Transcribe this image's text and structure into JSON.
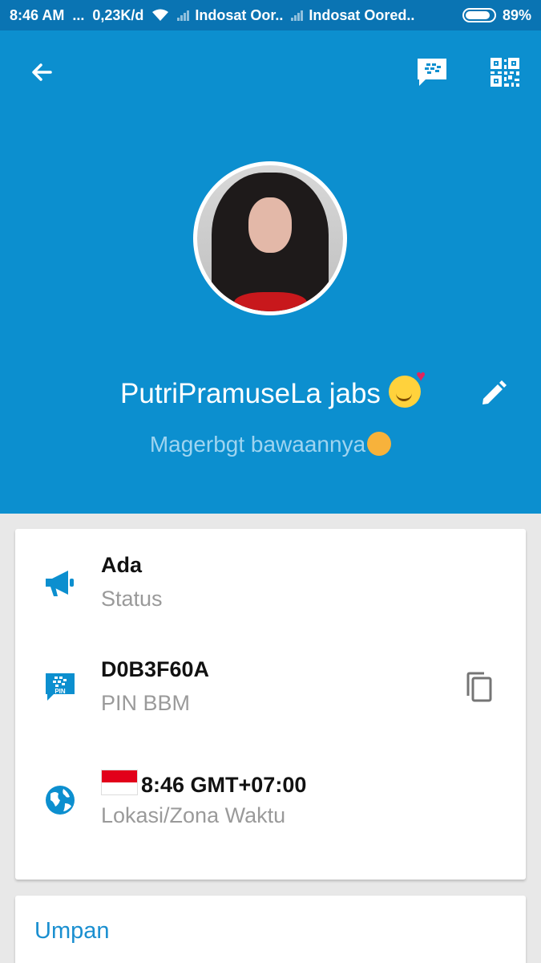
{
  "status_bar": {
    "time": "8:46 AM",
    "dots": "...",
    "speed": "0,23K/d",
    "carrier1": "Indosat Oor..",
    "carrier2": "Indosat Oored..",
    "battery": "89%"
  },
  "header": {
    "icons": [
      "back-arrow-icon",
      "bbm-chat-icon",
      "qr-code-icon"
    ],
    "name": "PutriPramuseLa jabs",
    "name_emoji": "smile-heart-emoji-icon",
    "status_message": "Magerbgt bawaannya",
    "status_emoji": "sad-emoji-icon",
    "bg_color": "#0c8fcf",
    "status_bar_color": "#0a74b3"
  },
  "info": {
    "availability": {
      "title": "Ada",
      "label": "Status",
      "icon": "megaphone-icon"
    },
    "pin": {
      "title": "D0B3F60A",
      "label": "PIN BBM",
      "icon": "bbm-pin-icon",
      "action_icon": "copy-icon"
    },
    "location": {
      "title": "8:46 GMT+07:00",
      "label": "Lokasi/Zona Waktu",
      "icon": "globe-icon",
      "flag": "indonesia-flag-icon"
    }
  },
  "feed": {
    "title": "Umpan"
  },
  "colors": {
    "accent": "#1a8fd0",
    "icon_blue": "#0c8fcf"
  }
}
